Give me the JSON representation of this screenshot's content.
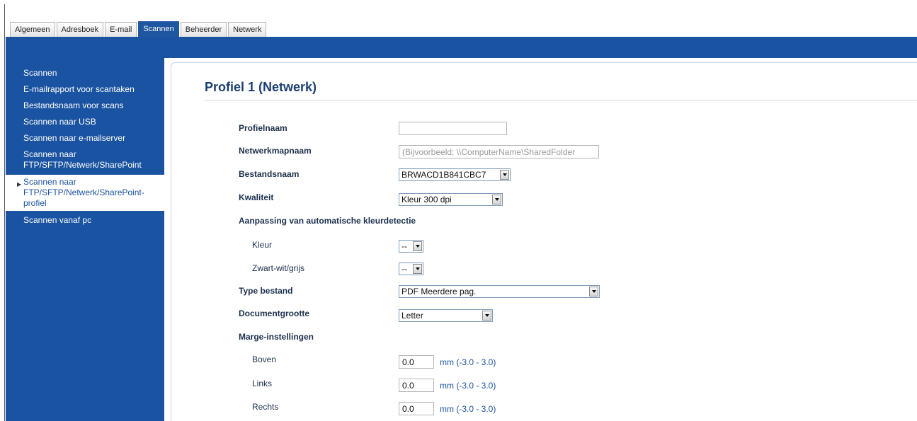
{
  "tabs": [
    "Algemeen",
    "Adresboek",
    "E-mail",
    "Scannen",
    "Beheerder",
    "Netwerk"
  ],
  "active_tab": "Scannen",
  "sidebar": {
    "items": [
      {
        "label": "Scannen"
      },
      {
        "label": "E-mailrapport voor scantaken"
      },
      {
        "label": "Bestandsnaam voor scans"
      },
      {
        "label": "Scannen naar USB"
      },
      {
        "label": "Scannen naar e-mailserver"
      },
      {
        "label": "Scannen naar FTP/SFTP/Netwerk/SharePoint"
      },
      {
        "label": "Scannen naar FTP/SFTP/Netwerk/SharePoint-profiel",
        "active": true
      },
      {
        "label": "Scannen vanaf pc"
      }
    ]
  },
  "page": {
    "title": "Profiel 1 (Netwerk)"
  },
  "form": {
    "profielnaam": {
      "label": "Profielnaam",
      "value": ""
    },
    "netwerkmap": {
      "label": "Netwerkmapnaam",
      "placeholder": "(Bijvoorbeeld: \\\\ComputerName\\SharedFolder"
    },
    "bestandsnaam": {
      "label": "Bestandsnaam",
      "value": "BRWACD1B841CBC7"
    },
    "kwaliteit": {
      "label": "Kwaliteit",
      "value": "Kleur 300 dpi"
    },
    "kleurdetectie": {
      "label": "Aanpassing van automatische kleurdetectie",
      "kleur": {
        "label": "Kleur",
        "value": "--"
      },
      "zwartwit": {
        "label": "Zwart-wit/grijs",
        "value": "--"
      }
    },
    "type_bestand": {
      "label": "Type bestand",
      "value": "PDF Meerdere pag."
    },
    "documentgrootte": {
      "label": "Documentgrootte",
      "value": "Letter"
    },
    "marge": {
      "label": "Marge-instellingen",
      "boven": {
        "label": "Boven",
        "value": "0.0",
        "unit": "mm (-3.0 - 3.0)"
      },
      "links": {
        "label": "Links",
        "value": "0.0",
        "unit": "mm (-3.0 - 3.0)"
      },
      "rechts": {
        "label": "Rechts",
        "value": "0.0",
        "unit": "mm (-3.0 - 3.0)"
      }
    }
  }
}
